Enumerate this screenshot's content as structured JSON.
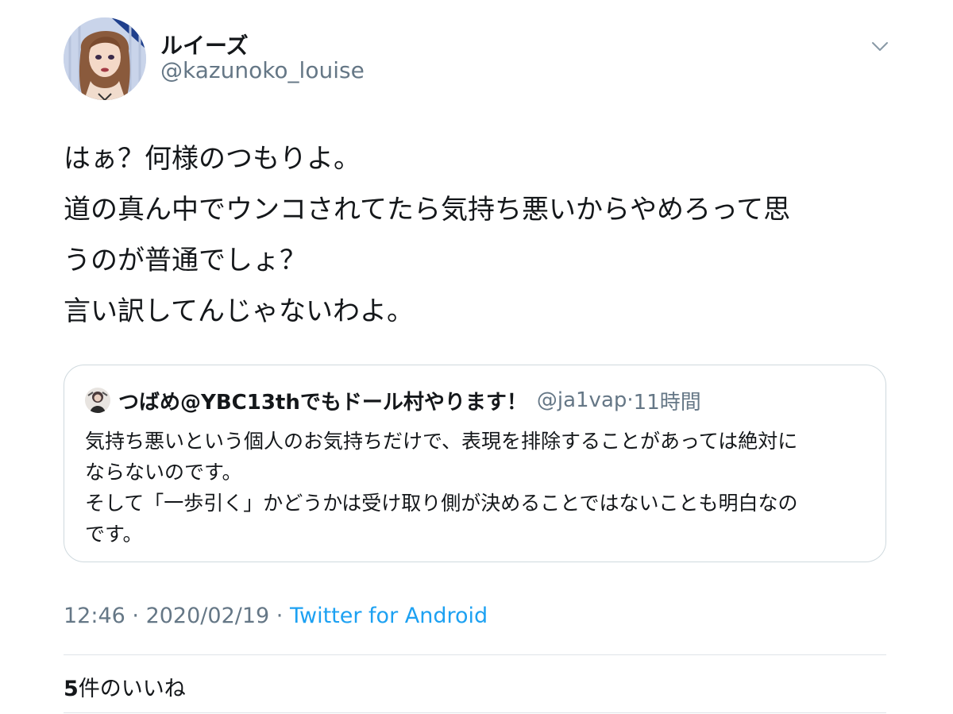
{
  "author": {
    "display_name": "ルイーズ",
    "handle": "@kazunoko_louise"
  },
  "tweet": {
    "lines": [
      "はぁ？何様のつもりよ。",
      "道の真ん中でウンコされてたら気持ち悪いからやめろって思",
      "うのが普通でしょ？",
      "言い訳してんじゃないわよ。"
    ]
  },
  "quote": {
    "display_name": "つばめ@YBC13thでもドール村やります！",
    "handle": "@ja1vap",
    "separator": "·",
    "time": "11時間",
    "lines": [
      "気持ち悪いという個人のお気持ちだけで、表現を排除することがあっては絶対に",
      "ならないのです。",
      "そして「一歩引く」かどうかは受け取り側が決めることではないことも明白なの",
      "です。"
    ]
  },
  "meta": {
    "time": "12:46",
    "separator": "·",
    "date": "2020/02/19",
    "source": "Twitter for Android"
  },
  "likes": {
    "count": "5",
    "label": "件のいいね"
  },
  "icons": {
    "menu": "chevron-down-icon"
  },
  "colors": {
    "text": "#14171a",
    "secondary": "#657786",
    "accent": "#1da1f2",
    "border": "#cfd9de"
  }
}
